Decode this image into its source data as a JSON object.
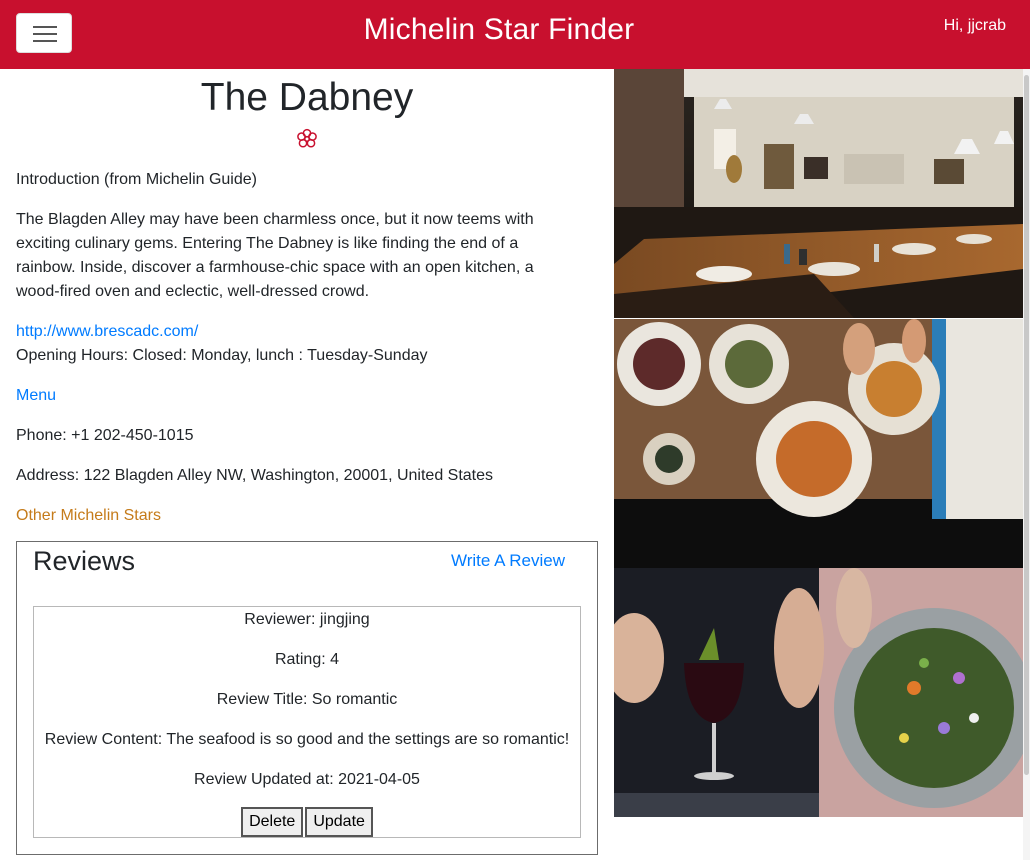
{
  "header": {
    "title": "Michelin Star Finder",
    "user_greeting": "Hi, jjcrab"
  },
  "restaurant": {
    "name": "The Dabney",
    "intro_label": "Introduction (from Michelin Guide)",
    "description": "The Blagden Alley may have been charmless once, but it now teems with exciting culinary gems. Entering The Dabney is like finding the end of a rainbow. Inside, discover a farmhouse-chic space with an open kitchen, a wood-fired oven and eclectic, well-dressed crowd.",
    "website": "http://www.brescadc.com/",
    "opening_hours": "Opening Hours: Closed: Monday, lunch : Tuesday-Sunday",
    "menu_link": "Menu",
    "phone": "Phone: +1 202-450-1015",
    "address": "Address: 122 Blagden Alley NW, Washington, 20001, United States",
    "other_stars_link": "Other Michelin Stars"
  },
  "reviews": {
    "title": "Reviews",
    "write_link": "Write A Review",
    "items": [
      {
        "reviewer": "Reviewer: jingjing",
        "rating": "Rating: 4",
        "title": "Review Title: So romantic",
        "content": "Review Content: The seafood is so good and the settings are so romantic!",
        "updated": "Review Updated at: 2021-04-05",
        "delete_label": "Delete",
        "update_label": "Update"
      }
    ]
  },
  "colors": {
    "navbar": "#c8102e",
    "star": "#c8102e",
    "link": "#007bff",
    "other_link": "#c57b1a"
  }
}
